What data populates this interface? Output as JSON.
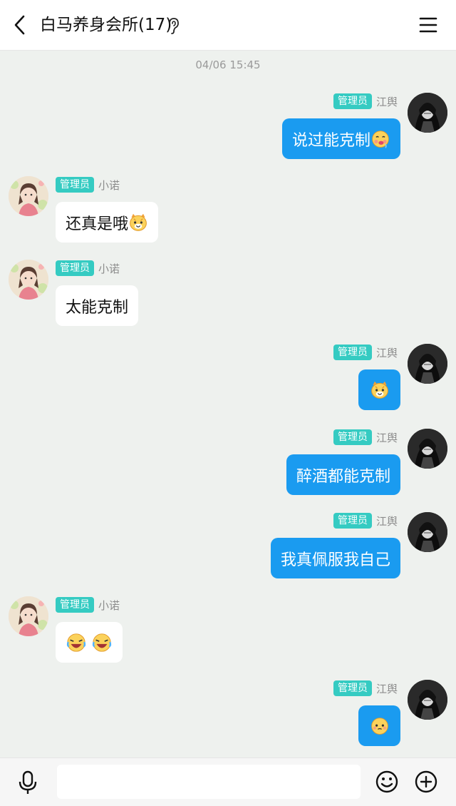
{
  "header": {
    "title": "白马养身会所(17)",
    "back_icon": "back-arrow-icon",
    "mode_icon": "ear-icon",
    "menu_icon": "menu-icon"
  },
  "chat": {
    "timestamp": "04/06 15:45",
    "messages": [
      {
        "side": "right",
        "badge": "管理员",
        "name": "江舆",
        "text": "说过能克制",
        "emoji": "drooling-face"
      },
      {
        "side": "left",
        "badge": "管理员",
        "name": "小诺",
        "text": "还真是哦",
        "emoji": "cat-face"
      },
      {
        "side": "left",
        "badge": "管理员",
        "name": "小诺",
        "text": "太能克制",
        "emoji": ""
      },
      {
        "side": "right",
        "badge": "管理员",
        "name": "江舆",
        "text": "",
        "emoji": "cat-face"
      },
      {
        "side": "right",
        "badge": "管理员",
        "name": "江舆",
        "text": "醉酒都能克制",
        "emoji": ""
      },
      {
        "side": "right",
        "badge": "管理员",
        "name": "江舆",
        "text": "我真佩服我自己",
        "emoji": ""
      },
      {
        "side": "left",
        "badge": "管理员",
        "name": "小诺",
        "text": "",
        "emoji": "laughing-crying-face x2"
      },
      {
        "side": "right",
        "badge": "管理员",
        "name": "江舆",
        "text": "",
        "emoji": "pleading-face"
      }
    ]
  },
  "bottom": {
    "input_placeholder": "",
    "voice_icon": "microphone-icon",
    "emoji_icon": "smiley-icon",
    "plus_icon": "plus-circle-icon"
  },
  "colors": {
    "background": "#eef1ee",
    "bubble_blue": "#1a9bf0",
    "badge": "#35cbc2"
  }
}
